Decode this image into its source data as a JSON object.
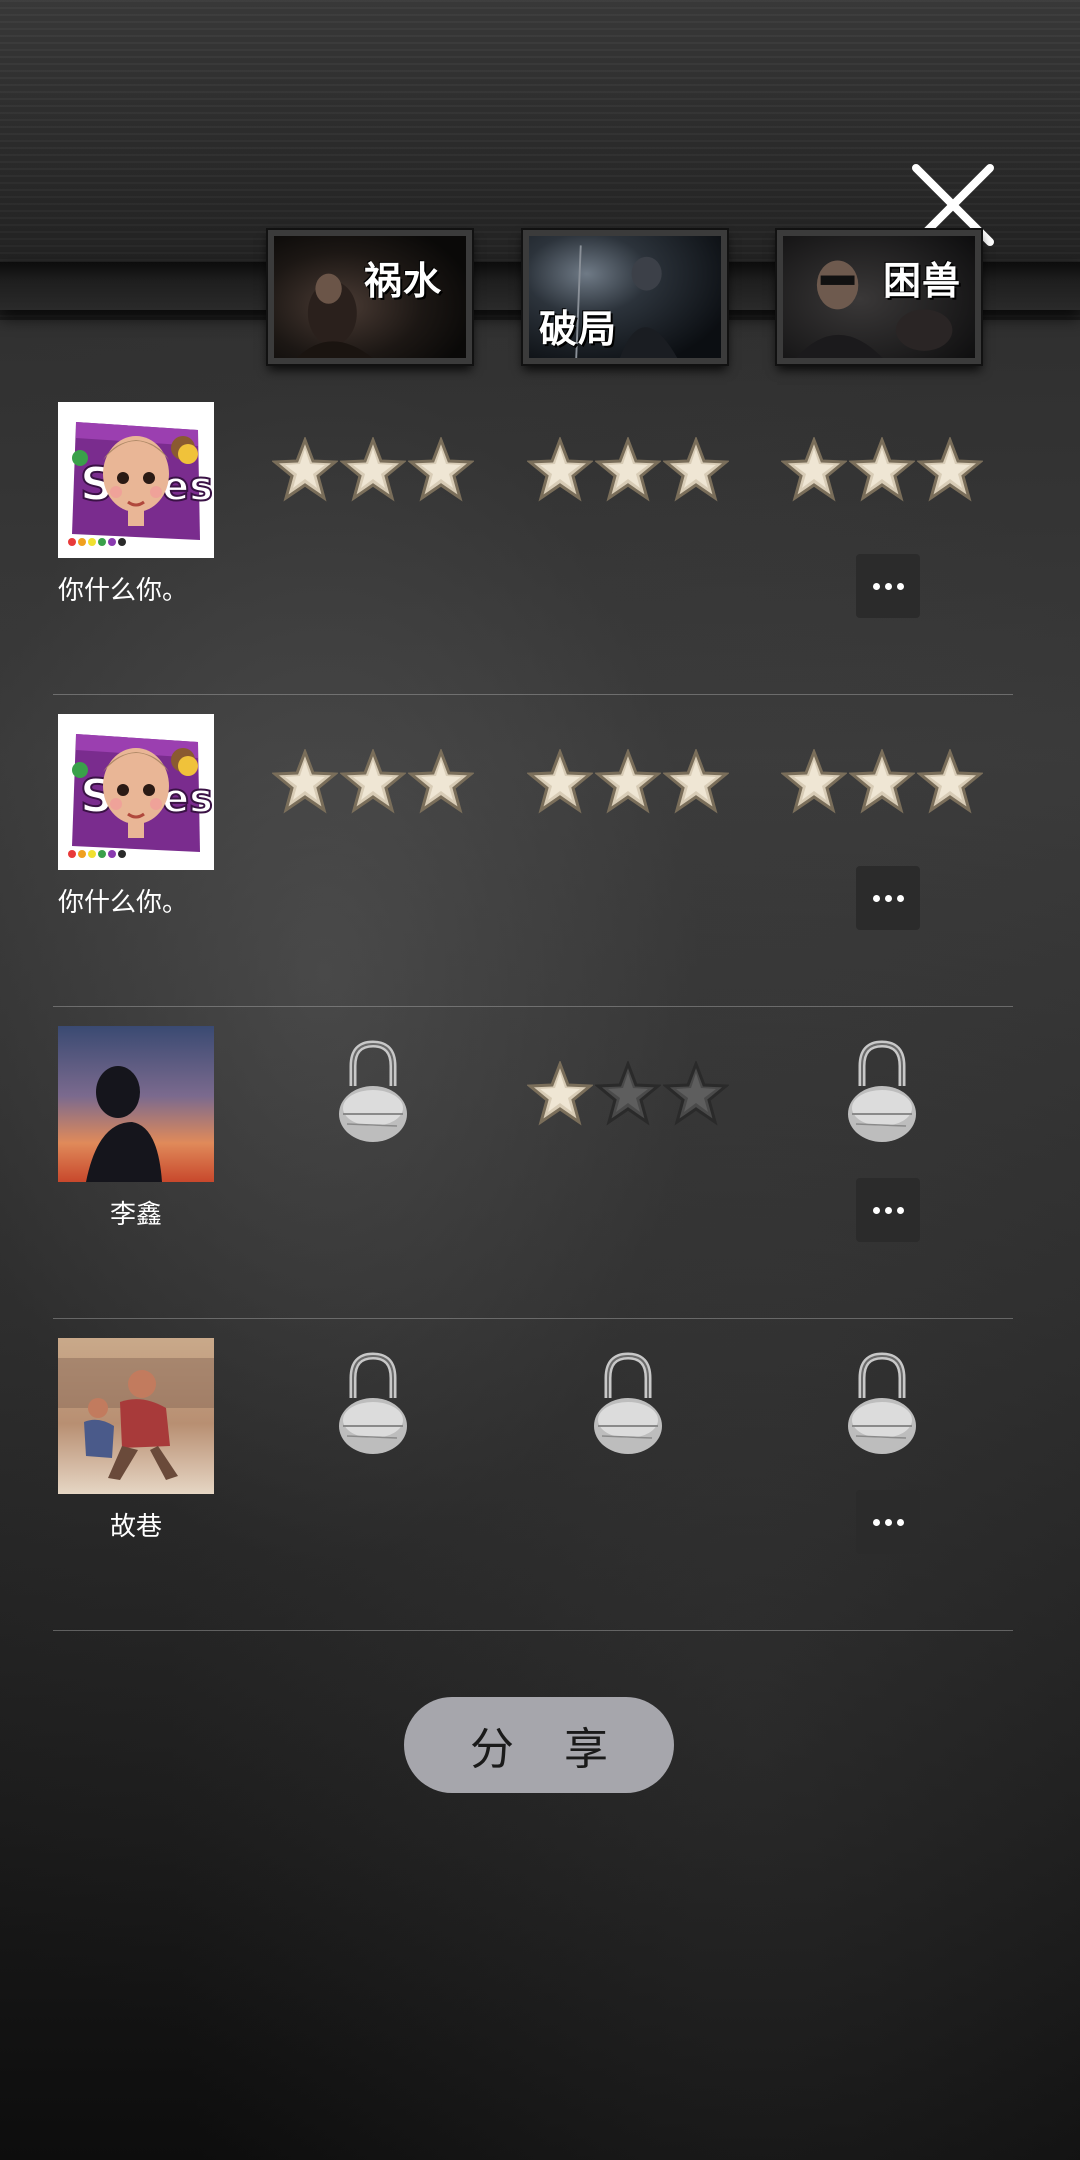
{
  "levels": [
    {
      "title": "祸水"
    },
    {
      "title": "破局"
    },
    {
      "title": "困兽"
    }
  ],
  "players": [
    {
      "name": "你什么你。",
      "avatar": "candy-bag-avatar",
      "results": [
        {
          "status": "stars",
          "stars": 3
        },
        {
          "status": "stars",
          "stars": 3
        },
        {
          "status": "stars",
          "stars": 3
        }
      ]
    },
    {
      "name": "你什么你。",
      "avatar": "candy-bag-avatar",
      "results": [
        {
          "status": "stars",
          "stars": 3
        },
        {
          "status": "stars",
          "stars": 3
        },
        {
          "status": "stars",
          "stars": 3
        }
      ]
    },
    {
      "name": "李鑫",
      "avatar": "sunset-silhouette-avatar",
      "results": [
        {
          "status": "locked"
        },
        {
          "status": "stars",
          "stars": 1
        },
        {
          "status": "locked"
        }
      ]
    },
    {
      "name": "故巷",
      "avatar": "kids-photo-avatar",
      "results": [
        {
          "status": "locked"
        },
        {
          "status": "locked"
        },
        {
          "status": "locked"
        }
      ]
    }
  ],
  "share_label": "分 享",
  "icons": {
    "close": "close-icon",
    "more": "more-dots-icon",
    "star": "star-icon",
    "lock": "padlock-icon"
  },
  "colors": {
    "star_filled": "#d8ccb6",
    "star_empty": "#5a5a5a",
    "share_bg": "#a6a6ac",
    "more_bg": "#2b2b2b"
  }
}
